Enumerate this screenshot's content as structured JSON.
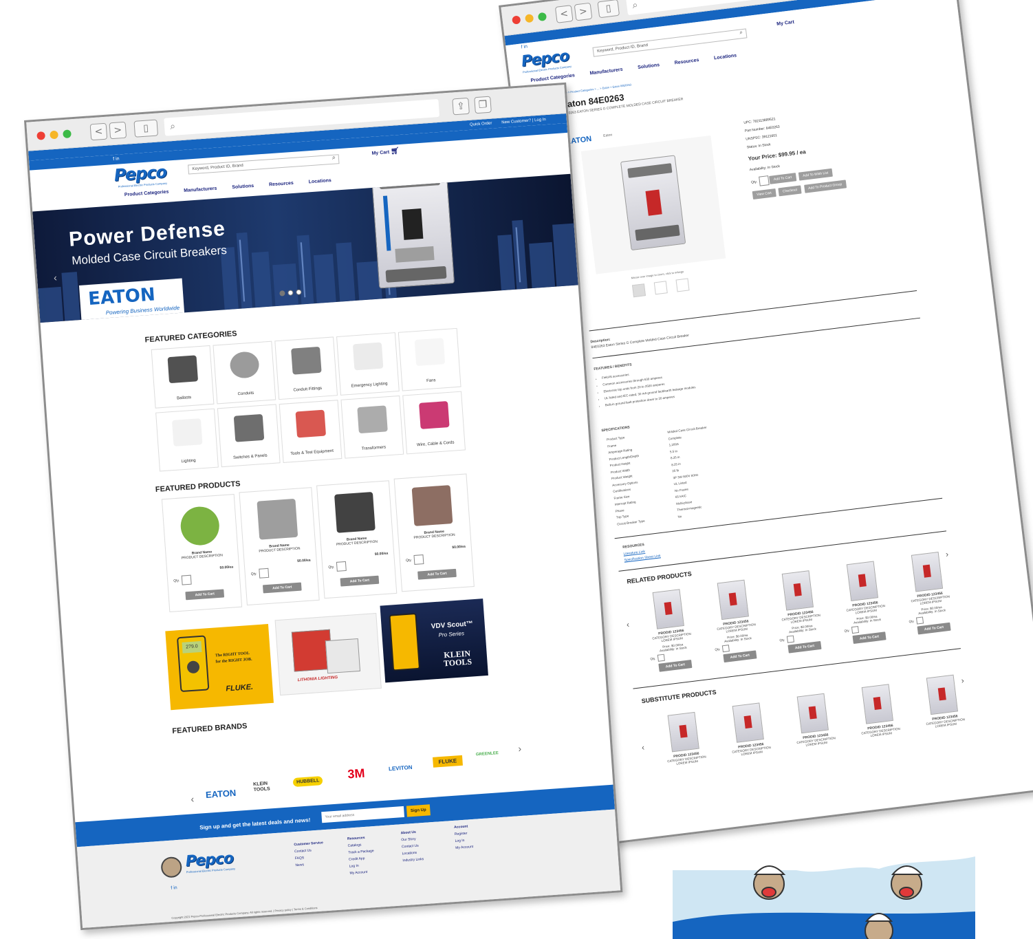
{
  "browser": {
    "back": "<",
    "forward": ">",
    "share_icon": "share-icon",
    "tabs_icon": "tabs-icon"
  },
  "site": {
    "logo": "Pepco",
    "logo_sub": "Professional Electric Products Company",
    "quick_order": "Quick Order",
    "account_link": "New Customer? | Log In",
    "social": "f in",
    "search_placeholder": "Keyword, Product ID, Brand",
    "search_placeholder_home": "Keyword, Product ID, Brand",
    "cart": "My Cart",
    "nav": [
      "Product Categories",
      "Manufacturers",
      "Solutions",
      "Resources",
      "Locations"
    ]
  },
  "home": {
    "hero": {
      "title": "Power Defense",
      "subtitle": "Molded Case Circuit Breakers",
      "brand": "EATON",
      "tagline": "Powering Business Worldwide"
    },
    "featured_categories_title": "FEATURED CATEGORIES",
    "categories": [
      "Ballasts",
      "Conduits",
      "Conduit Fittings",
      "Emergency Lighting",
      "Fans",
      "Lighting",
      "Switches & Panels",
      "Tools & Test Equipment",
      "Transformers",
      "Wire, Cable & Cords"
    ],
    "featured_products_title": "FEATURED PRODUCTS",
    "products": [
      {
        "brand": "Brand Name",
        "desc": "PRODUCT DESCRIPTION",
        "price": "$0.00/ea",
        "qty": "Qty.",
        "btn": "Add To Cart"
      },
      {
        "brand": "Brand Name",
        "desc": "PRODUCT DESCRIPTION",
        "price": "$0.00/ea",
        "qty": "Qty.",
        "btn": "Add To Cart"
      },
      {
        "brand": "Brand Name",
        "desc": "PRODUCT DESCRIPTION",
        "price": "$0.00/ea",
        "qty": "Qty.",
        "btn": "Add To Cart"
      },
      {
        "brand": "Brand Name",
        "desc": "PRODUCT DESCRIPTION",
        "price": "$0.00/ea",
        "qty": "Qty.",
        "btn": "Add To Cart"
      }
    ],
    "promos": [
      {
        "line1": "The RIGHT TOOL",
        "line2": "for the RIGHT JOB.",
        "brand": "FLUKE."
      },
      {
        "brand": "LITHONIA LIGHTING"
      },
      {
        "line1": "VDV Scout™",
        "line2": "Pro Series",
        "brand": "KLEIN TOOLS"
      }
    ],
    "meter_reading": "279.0",
    "featured_brands_title": "FEATURED BRANDS",
    "brands": [
      "EATON",
      "KLEIN TOOLS",
      "HUBBELL",
      "3M",
      "LEVITON",
      "FLUKE",
      "GREENLEE"
    ],
    "signup_text": "Sign up and get the latest deals and news!",
    "signup_placeholder": "Your email address",
    "signup_btn": "Sign Up",
    "footer_cols": [
      [
        "Customer Service",
        "Contact Us",
        "FAQS",
        "News"
      ],
      [
        "Resources",
        "Catalogs",
        "Track a Package",
        "Credit App",
        "Log In",
        "My Account"
      ],
      [
        "About Us",
        "Our Story",
        "Contact Us",
        "Locations",
        "Industry Links"
      ],
      [
        "Account",
        "Register",
        "Log In",
        "My Account"
      ]
    ],
    "copyright": "Copyright 2021 Pepco-Professional Electric Products Company. All rights reserved. | Privacy policy | Terms & Conditions"
  },
  "detail": {
    "breadcrumb": "Home > Product Categories > ... > Eaton > Eaton 84E0263",
    "title": "Eaton 84E0263",
    "subtitle": "84E0263 EATON SERIES G COMPLETE MOLDED CASE CIRCUIT BREAKER",
    "brand_logo": "EATON",
    "brand_name": "Eaton",
    "upc": "UPC: 782113889521",
    "part_number": "Part Number: 84E0263",
    "unspsc": "UNSPSC: 39121601",
    "status": "Status: In Stock",
    "price_label": "Your Price:",
    "price": "$99.95 / ea",
    "availability": "Availability: In Stock",
    "qty": "Qty.",
    "buttons": [
      "Add To Cart",
      "Add To Wish List",
      "View Cart",
      "Checkout",
      "Add To Product Group"
    ],
    "image_caption": "Mouse over image to zoom, click to enlarge",
    "description_label": "Description:",
    "description": "84E0263 Eaton Series G Complete Molded Case Circuit Breaker",
    "features_title": "FEATURES / BENEFITS",
    "features": [
      "Field-fit accessories",
      "Common accessories through 630 amperes",
      "Electronic trip units from 20 to 2500 amperes",
      "UL listed and IEC-rated, 30 mA ground fault/earth leakage modules",
      "Built-in ground fault protection down to 20 amperes"
    ],
    "specs_title": "SPECIFICATIONS",
    "specs": [
      [
        "Product Type",
        "Molded Case Circuit Breaker"
      ],
      [
        "Frame",
        "Complete"
      ],
      [
        "Amperage Rating",
        "1,200A"
      ],
      [
        "Product Length/Depth",
        "5.5 in"
      ],
      [
        "Product Height",
        "8.25 in"
      ],
      [
        "Product Width",
        "8.25 in"
      ],
      [
        "Product Weight",
        "25 lb"
      ],
      [
        "Accessory Options",
        "3P 3W 600V 60Hz"
      ],
      [
        "Certifications",
        "UL Listed"
      ],
      [
        "Frame Size",
        "No Frame"
      ],
      [
        "Interrupt Rating",
        "65 kAIC"
      ],
      [
        "Phase",
        "Multi-phase"
      ],
      [
        "Trip Type",
        "Thermal-magnetic"
      ],
      [
        "Circuit Breaker Type",
        "No"
      ]
    ],
    "resources_title": "RESOURCES",
    "resources": [
      "Literature Link",
      "Specification Sheet Link"
    ],
    "related_title": "RELATED PRODUCTS",
    "related": [
      {
        "name": "PRODID 123456",
        "desc": "CATEGORY DESCRIPTION LOREM IPSUM",
        "price": "Price: $0.00/ea",
        "avail": "Availability: In Stock",
        "qty": "Qty.",
        "btn": "Add To Cart"
      },
      {
        "name": "PRODID 123456",
        "desc": "CATEGORY DESCRIPTION LOREM IPSUM",
        "price": "Price: $0.00/ea",
        "avail": "Availability: In Stock",
        "qty": "Qty.",
        "btn": "Add To Cart"
      },
      {
        "name": "PRODID 123456",
        "desc": "CATEGORY DESCRIPTION LOREM IPSUM",
        "price": "Price: $0.00/ea",
        "avail": "Availability: In Stock",
        "qty": "Qty.",
        "btn": "Add To Cart"
      },
      {
        "name": "PRODID 123456",
        "desc": "CATEGORY DESCRIPTION LOREM IPSUM",
        "price": "Price: $0.00/ea",
        "avail": "Availability: In Stock",
        "qty": "Qty.",
        "btn": "Add To Cart"
      },
      {
        "name": "PRODID 123456",
        "desc": "CATEGORY DESCRIPTION LOREM IPSUM",
        "price": "Price: $0.00/ea",
        "avail": "Availability: In Stock",
        "qty": "Qty.",
        "btn": "Add To Cart"
      }
    ],
    "substitute_title": "SUBSTITUTE PRODUCTS",
    "substitutes": [
      {
        "name": "PRODID 123456",
        "desc": "CATEGORY DESCRIPTION LOREM IPSUM"
      },
      {
        "name": "PRODID 123456",
        "desc": "CATEGORY DESCRIPTION LOREM IPSUM"
      },
      {
        "name": "PRODID 123456",
        "desc": "CATEGORY DESCRIPTION LOREM IPSUM"
      },
      {
        "name": "PRODID 123456",
        "desc": "CATEGORY DESCRIPTION LOREM IPSUM"
      },
      {
        "name": "PRODID 123456",
        "desc": "CATEGORY DESCRIPTION LOREM IPSUM"
      }
    ]
  },
  "colors": {
    "brand_blue": "#1565c0",
    "accent_yellow": "#f6b800",
    "nav_text": "#1a237e"
  }
}
